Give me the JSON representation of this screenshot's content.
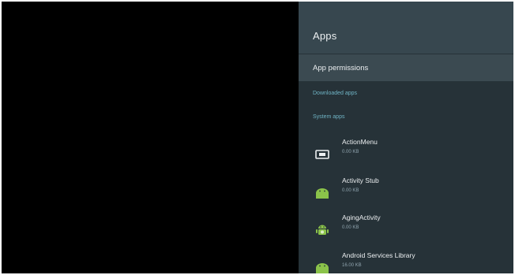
{
  "panel": {
    "title": "Apps",
    "permissions_label": "App permissions",
    "section_downloaded": "Downloaded apps",
    "section_system": "System apps",
    "apps": [
      {
        "name": "ActionMenu",
        "size": "0.00 KB",
        "icon": "tv-icon"
      },
      {
        "name": "Activity Stub",
        "size": "0.00 KB",
        "icon": "android-icon"
      },
      {
        "name": "AgingActivity",
        "size": "0.00 KB",
        "icon": "android-icon"
      },
      {
        "name": "Android Services Library",
        "size": "16.00 KB",
        "icon": "android-icon"
      }
    ]
  },
  "colors": {
    "panel_bg": "#263238",
    "header_bg": "#37474f",
    "selected_row_bg": "#3b4a51",
    "section_text": "#6fb3c4",
    "android_green": "#8bc34a"
  }
}
